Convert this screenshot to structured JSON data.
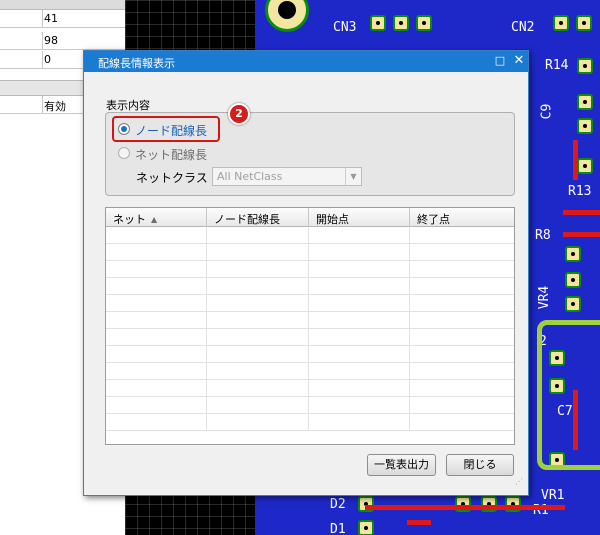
{
  "background": {
    "left_panel": {
      "rows": [
        {
          "value": "41"
        },
        {
          "value": "98"
        },
        {
          "value": "0"
        },
        {
          "value": "有効"
        }
      ]
    },
    "pcb_labels": [
      "CN3",
      "CN2",
      "R14",
      "C9",
      "R13",
      "R8",
      "VR4",
      "2",
      "C7",
      "D2",
      "D1",
      "VR1",
      "R1"
    ]
  },
  "dialog": {
    "title": "配線長情報表示",
    "maximize_icon": "□",
    "close_icon": "✕",
    "display_section": {
      "label": "表示内容",
      "options": [
        {
          "label": "ノード配線長",
          "checked": true
        },
        {
          "label": "ネット配線長",
          "checked": false
        }
      ],
      "step_badge": "2",
      "netclass_label": "ネットクラス",
      "netclass_value": "All NetClass"
    },
    "table": {
      "columns": [
        "ネット",
        "ノード配線長",
        "開始点",
        "終了点"
      ],
      "sort_icon": "▲",
      "empty_row_count": 12
    },
    "buttons": {
      "export": "一覧表出力",
      "close": "閉じる"
    }
  },
  "colors": {
    "titlebar": "#1b7ad1",
    "highlight": "#d01818",
    "pcb_board": "#1e28c8",
    "pad_border": "#0c8c0c"
  }
}
